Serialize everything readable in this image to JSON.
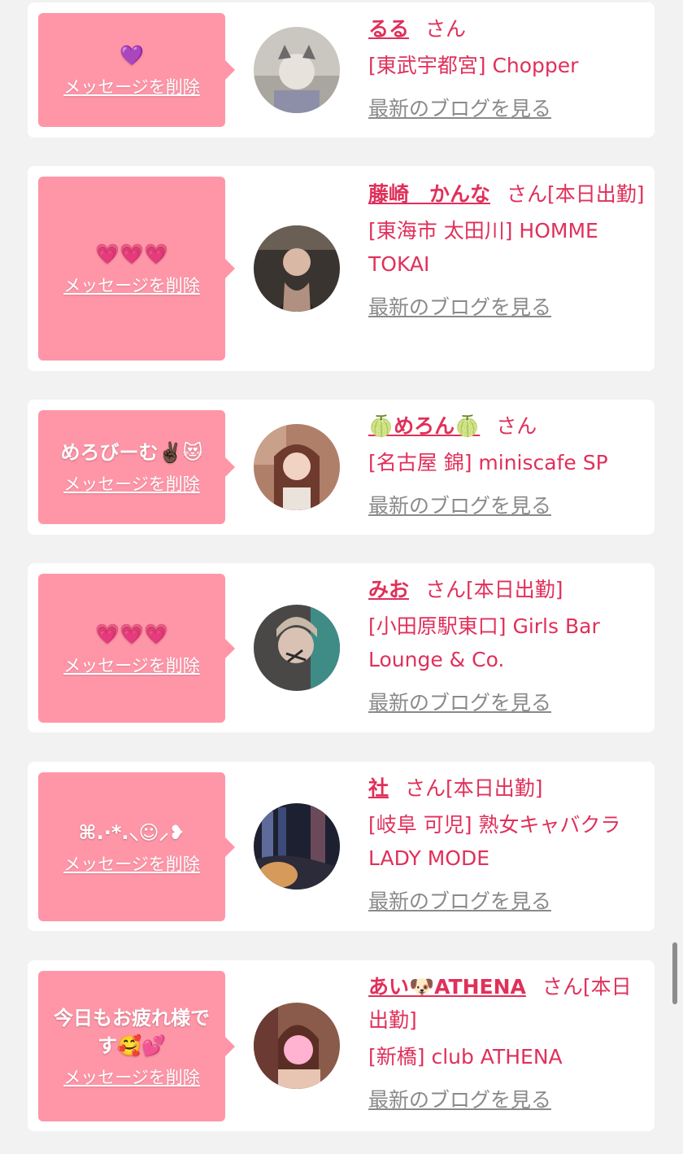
{
  "delete_label": "メッセージを削除",
  "blog_label": "最新のブログを見る",
  "san_label": "さん",
  "cards": [
    {
      "message": "💜",
      "name": "るる",
      "suffix": "",
      "shop": "[東武宇都宮] Chopper",
      "avatar_icon": "avatar-photo"
    },
    {
      "message": "💗💗💗",
      "name": "藤崎　かんな",
      "suffix": "[本日出勤]",
      "shop": "[東海市 太田川] HOMME TOKAI",
      "avatar_icon": "avatar-photo"
    },
    {
      "message": "めろびーむ✌🏿😻",
      "name": "🍈めろん🍈",
      "suffix": "",
      "shop": "[名古屋 錦] miniscafe SP",
      "avatar_icon": "avatar-photo"
    },
    {
      "message": "💗💗💗",
      "name": "みお",
      "suffix": "[本日出勤]",
      "shop": "[小田原駅東口] Girls Bar Lounge & Co.",
      "avatar_icon": "avatar-photo"
    },
    {
      "message": "⌘.·*.⸜☺︎⸝❥",
      "name": "社",
      "suffix": "[本日出勤]",
      "shop": "[岐阜 可児] 熟女キャバクラ LADY MODE",
      "avatar_icon": "avatar-photo"
    },
    {
      "message": "今日もお疲れ様です🥰💕",
      "name": "あい🐶ATHENA",
      "suffix": "[本日出勤]",
      "shop": "[新橋] club ATHENA",
      "avatar_icon": "avatar-photo"
    }
  ]
}
